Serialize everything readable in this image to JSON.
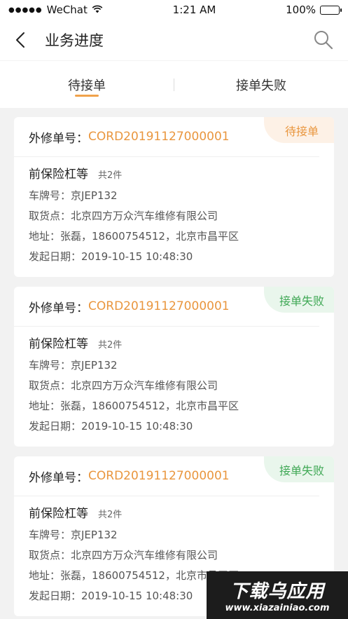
{
  "status_bar": {
    "carrier": "WeChat",
    "time": "1:21 AM",
    "battery": "100%"
  },
  "nav": {
    "title": "业务进度"
  },
  "tabs": [
    {
      "label": "待接单",
      "active": true
    },
    {
      "label": "接单失败",
      "active": false
    }
  ],
  "cards": [
    {
      "status": "待接单",
      "status_kind": "pending",
      "order_label": "外修单号：",
      "order_no": "CORD20191127000001",
      "part_name": "前保险杠等",
      "part_count": "共2件",
      "plate": "车牌号：京JEP132",
      "pickup": "取货点：北京四方万众汽车维修有限公司",
      "address": "地址：张磊，18600754512，北京市昌平区",
      "date": "发起日期：2019-10-15 10:48:30"
    },
    {
      "status": "接单失败",
      "status_kind": "failed",
      "order_label": "外修单号：",
      "order_no": "CORD20191127000001",
      "part_name": "前保险杠等",
      "part_count": "共2件",
      "plate": "车牌号：京JEP132",
      "pickup": "取货点：北京四方万众汽车维修有限公司",
      "address": "地址：张磊，18600754512，北京市昌平区",
      "date": "发起日期：2019-10-15 10:48:30"
    },
    {
      "status": "接单失败",
      "status_kind": "failed",
      "order_label": "外修单号：",
      "order_no": "CORD20191127000001",
      "part_name": "前保险杠等",
      "part_count": "共2件",
      "plate": "车牌号：京JEP132",
      "pickup": "取货点：北京四方万众汽车维修有限公司",
      "address": "地址：张磊，18600754512，北京市昌平区",
      "date": "发起日期：2019-10-15 10:48:30"
    }
  ],
  "watermark": {
    "main": "下载乌应用",
    "sub": "www.xiazainiao.com"
  },
  "colors": {
    "accent": "#e9963e",
    "success": "#3fa855",
    "background": "#f2f2f2"
  },
  "icons": {
    "back": "back-arrow-icon",
    "search": "search-icon",
    "wifi": "wifi-icon",
    "signal": "signal-icon",
    "battery": "battery-icon"
  }
}
